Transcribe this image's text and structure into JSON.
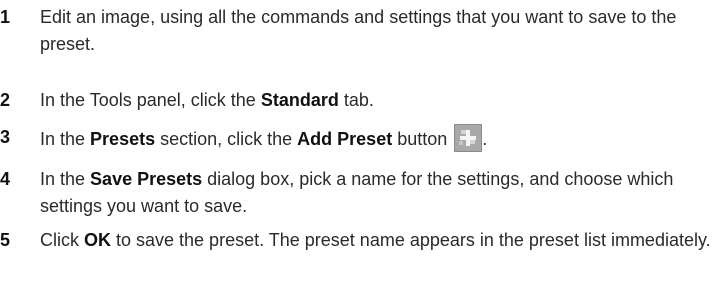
{
  "steps": [
    {
      "number": "1",
      "text": "Edit an image, using all the commands and settings that you want to save to the preset."
    },
    {
      "number": "2",
      "text_before": "In the Tools panel, click the ",
      "bold": "Standard",
      "text_after": " tab."
    },
    {
      "number": "3",
      "text_1": "In the ",
      "bold_1": "Presets",
      "text_2": " section, click the ",
      "bold_2": "Add Preset",
      "text_3": " button ",
      "text_4": ".",
      "icon": "add-preset-icon"
    },
    {
      "number": "4",
      "text_1": "In the ",
      "bold_1": "Save Presets",
      "text_2": " dialog box, pick a name for the settings, and choose which settings you want to save."
    },
    {
      "number": "5",
      "text_1": "Click ",
      "bold_1": "OK",
      "text_2": " to save the preset. The preset name appears in the preset list immediately."
    }
  ],
  "colors": {
    "text": "#2a2a2a",
    "icon_background": "#a8a8a8"
  }
}
